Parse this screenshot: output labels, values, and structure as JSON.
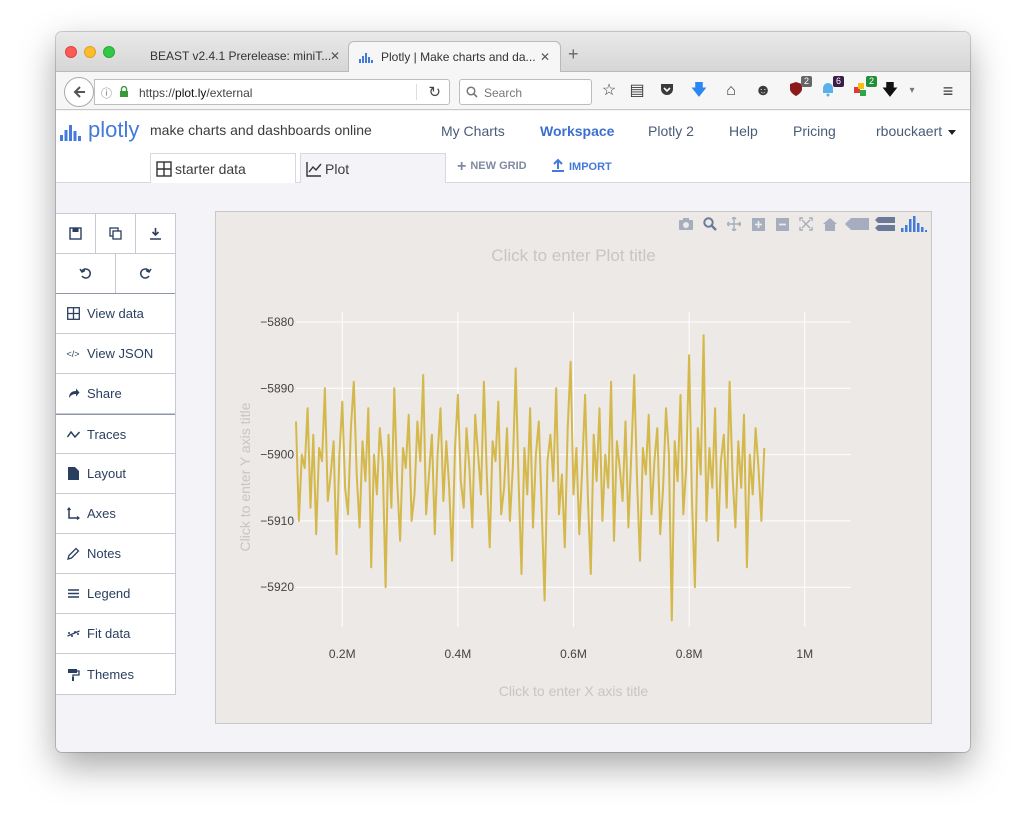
{
  "browser": {
    "tabs": [
      {
        "title": "BEAST v2.4.1 Prerelease: miniT...",
        "active": false
      },
      {
        "title": "Plotly | Make charts and da...",
        "active": true
      }
    ],
    "url_prefix": "https://",
    "url_domain": "plot.ly",
    "url_path": "/external",
    "search_placeholder": "Search",
    "badges": [
      "2",
      "6",
      "2"
    ]
  },
  "app": {
    "logo_text": "plotly",
    "tagline": "make charts and dashboards online",
    "nav": [
      "My Charts",
      "Workspace",
      "Plotly 2",
      "Help",
      "Pricing"
    ],
    "active_nav": "Workspace",
    "user": "rbouckaert",
    "doc_tabs": [
      "starter data",
      "Plot"
    ],
    "new_grid": "NEW GRID",
    "import": "IMPORT"
  },
  "sidebar": {
    "items": [
      {
        "label": "View data",
        "icon": "grid-icon"
      },
      {
        "label": "View JSON",
        "icon": "code-icon"
      },
      {
        "label": "Share",
        "icon": "share-icon"
      },
      {
        "label": "Traces",
        "icon": "traces-icon"
      },
      {
        "label": "Layout",
        "icon": "layout-icon"
      },
      {
        "label": "Axes",
        "icon": "axes-icon"
      },
      {
        "label": "Notes",
        "icon": "pencil-icon"
      },
      {
        "label": "Legend",
        "icon": "legend-icon"
      },
      {
        "label": "Fit data",
        "icon": "fit-icon"
      },
      {
        "label": "Themes",
        "icon": "paint-roller-icon"
      }
    ]
  },
  "chart_data": {
    "type": "line",
    "title": "Click to enter Plot title",
    "xlabel": "Click to enter X axis title",
    "ylabel": "Click to enter Y axis title",
    "xlim": [
      120000,
      1080000
    ],
    "ylim": [
      -5926,
      -5880
    ],
    "xticks": [
      200000,
      400000,
      600000,
      800000,
      1000000
    ],
    "xtick_labels": [
      "0.2M",
      "0.4M",
      "0.6M",
      "0.8M",
      "1M"
    ],
    "yticks": [
      -5880,
      -5890,
      -5900,
      -5910,
      -5920
    ],
    "ytick_labels": [
      "−5880",
      "−5890",
      "−5900",
      "−5910",
      "−5920"
    ],
    "grid": true,
    "color": "#d4b84c",
    "series": [
      {
        "x_start": 120000,
        "x_step": 5000,
        "values": [
          -5895,
          -5910,
          -5900,
          -5902,
          -5893,
          -5908,
          -5897,
          -5912,
          -5899,
          -5901,
          -5890,
          -5907,
          -5903,
          -5898,
          -5915,
          -5900,
          -5892,
          -5905,
          -5909,
          -5896,
          -5889,
          -5903,
          -5911,
          -5898,
          -5904,
          -5893,
          -5917,
          -5900,
          -5906,
          -5896,
          -5901,
          -5920,
          -5897,
          -5908,
          -5890,
          -5904,
          -5913,
          -5899,
          -5902,
          -5894,
          -5910,
          -5906,
          -5895,
          -5901,
          -5888,
          -5909,
          -5903,
          -5897,
          -5912,
          -5900,
          -5893,
          -5907,
          -5898,
          -5905,
          -5916,
          -5899,
          -5891,
          -5904,
          -5908,
          -5896,
          -5902,
          -5911,
          -5894,
          -5900,
          -5906,
          -5889,
          -5903,
          -5914,
          -5898,
          -5901,
          -5892,
          -5909,
          -5905,
          -5896,
          -5910,
          -5902,
          -5887,
          -5904,
          -5918,
          -5899,
          -5906,
          -5893,
          -5911,
          -5900,
          -5895,
          -5908,
          -5922,
          -5901,
          -5897,
          -5904,
          -5890,
          -5909,
          -5903,
          -5914,
          -5896,
          -5886,
          -5906,
          -5899,
          -5912,
          -5902,
          -5891,
          -5907,
          -5918,
          -5897,
          -5904,
          -5893,
          -5910,
          -5900,
          -5905,
          -5889,
          -5913,
          -5898,
          -5902,
          -5907,
          -5895,
          -5911,
          -5900,
          -5888,
          -5904,
          -5916,
          -5899,
          -5903,
          -5894,
          -5909,
          -5901,
          -5896,
          -5912,
          -5905,
          -5893,
          -5900,
          -5925,
          -5898,
          -5904,
          -5891,
          -5909,
          -5902,
          -5885,
          -5907,
          -5920,
          -5896,
          -5903,
          -5882,
          -5910,
          -5899,
          -5905,
          -5893,
          -5913,
          -5901,
          -5897,
          -5908,
          -5889,
          -5903,
          -5911,
          -5898,
          -5905,
          -5894,
          -5917,
          -5900,
          -5906,
          -5896,
          -5902,
          -5910,
          -5899
        ]
      }
    ]
  }
}
